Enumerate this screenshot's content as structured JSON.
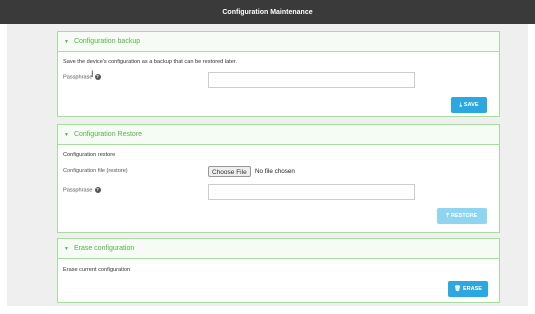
{
  "header": {
    "title": "Configuration Maintenance"
  },
  "backup": {
    "title": "Configuration backup",
    "description": "Save the device's configuration as a backup that can be restored later.",
    "passphrase_label": "Passphrase",
    "save_label": "SAVE"
  },
  "restore": {
    "title": "Configuration Restore",
    "subheading": "Configuration restore",
    "file_label": "Configuration file (restore)",
    "choose_file_label": "Choose File",
    "no_file_text": "No file chosen",
    "passphrase_label": "Passphrase",
    "restore_label": "RESTORE"
  },
  "erase": {
    "title": "Erase configuration",
    "description": "Erase current configuration",
    "erase_label": "ERASE"
  },
  "colors": {
    "topbar": "#3a3a3a",
    "panel_border": "#a8dba0",
    "section_title": "#58b24a",
    "primary_button": "#2aa8df",
    "disabled_button": "#8fd4f1"
  },
  "icons": {
    "collapse": "chevron-down-icon",
    "help": "question-icon",
    "save": "download-icon",
    "restore": "upload-icon",
    "erase": "trash-icon"
  }
}
